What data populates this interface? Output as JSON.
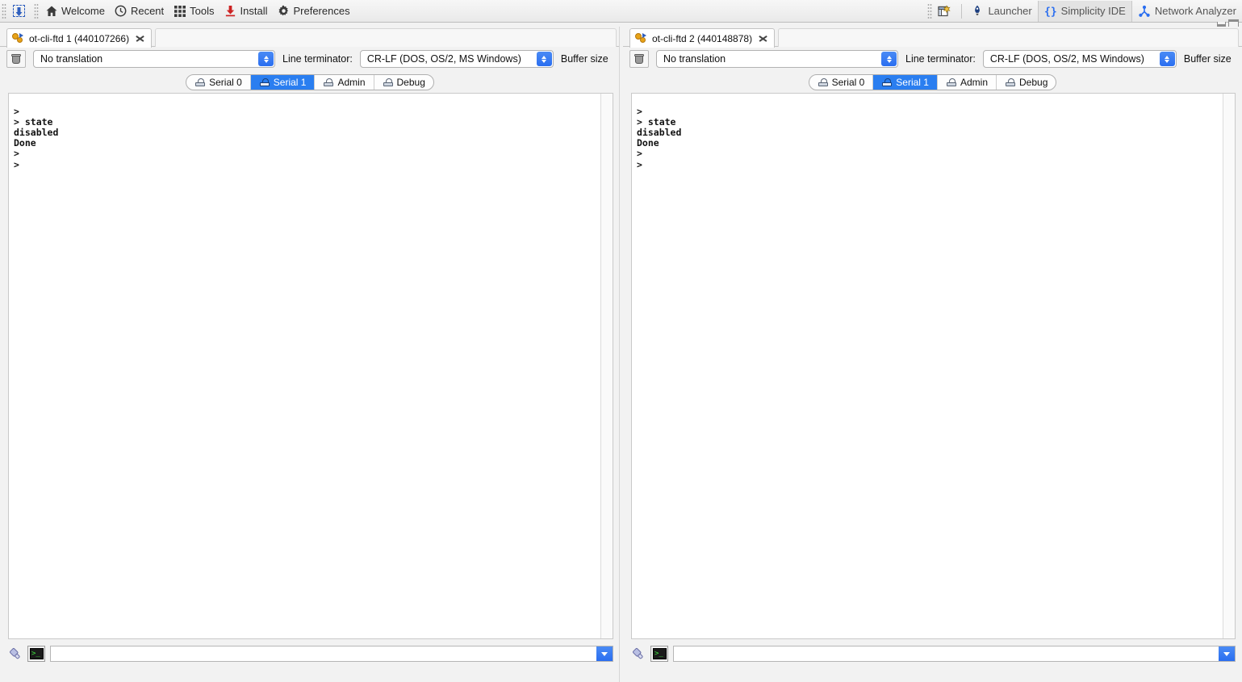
{
  "toolbar": {
    "left_items": [
      {
        "name": "flash-programmer",
        "icon": "chip-flash-icon",
        "label": ""
      },
      {
        "name": "welcome",
        "icon": "home-icon",
        "label": "Welcome"
      },
      {
        "name": "recent",
        "icon": "clock-icon",
        "label": "Recent"
      },
      {
        "name": "tools",
        "icon": "grid-icon",
        "label": "Tools"
      },
      {
        "name": "install",
        "icon": "download-icon",
        "label": "Install"
      },
      {
        "name": "preferences",
        "icon": "gear-icon",
        "label": "Preferences"
      }
    ],
    "right_items": [
      {
        "name": "open-perspective",
        "icon": "new-perspective-icon",
        "label": ""
      },
      {
        "name": "launcher",
        "icon": "launcher-icon",
        "label": "Launcher"
      },
      {
        "name": "simplicity-ide",
        "icon": "braces-icon",
        "label": "Simplicity IDE"
      },
      {
        "name": "network-analyzer",
        "icon": "network-icon",
        "label": "Network Analyzer"
      }
    ],
    "active_perspective": "Simplicity IDE",
    "accent_color": "#2a7ef0",
    "window_controls": {
      "minimize": "minimize-icon",
      "maximize": "maximize-icon"
    }
  },
  "panels": [
    {
      "editor_tab": {
        "title": "ot-cli-ftd 1 (440107266)",
        "icon": "serial-console-icon",
        "close": "close-icon"
      },
      "controls": {
        "clear_button_icon": "trash-icon",
        "translation_value": "No translation",
        "line_terminator_label": "Line terminator:",
        "line_terminator_value": "CR-LF  (DOS, OS/2, MS Windows)",
        "buffer_size_label": "Buffer size"
      },
      "serial_tabs": [
        {
          "label": "Serial 0",
          "active": false
        },
        {
          "label": "Serial 1",
          "active": true
        },
        {
          "label": "Admin",
          "active": false
        },
        {
          "label": "Debug",
          "active": false
        }
      ],
      "terminal_text": ">\n> state\ndisabled\nDone\n>\n>",
      "input": {
        "value": "",
        "placeholder": "",
        "connect_icon": "plug-icon",
        "console_icon": "console-icon",
        "dropdown_icon": "chevron-down-icon"
      }
    },
    {
      "editor_tab": {
        "title": "ot-cli-ftd 2 (440148878)",
        "icon": "serial-console-icon",
        "close": "close-icon"
      },
      "controls": {
        "clear_button_icon": "trash-icon",
        "translation_value": "No translation",
        "line_terminator_label": "Line terminator:",
        "line_terminator_value": "CR-LF  (DOS, OS/2, MS Windows)",
        "buffer_size_label": "Buffer size"
      },
      "serial_tabs": [
        {
          "label": "Serial 0",
          "active": false
        },
        {
          "label": "Serial 1",
          "active": true
        },
        {
          "label": "Admin",
          "active": false
        },
        {
          "label": "Debug",
          "active": false
        }
      ],
      "terminal_text": ">\n> state\ndisabled\nDone\n>\n>",
      "input": {
        "value": "",
        "placeholder": "",
        "connect_icon": "plug-icon",
        "console_icon": "console-icon",
        "dropdown_icon": "chevron-down-icon"
      }
    }
  ]
}
